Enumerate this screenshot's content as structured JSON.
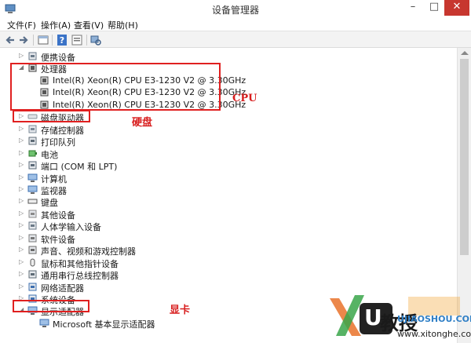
{
  "window": {
    "title": "设备管理器"
  },
  "menu": [
    "文件(F)",
    "操作(A)",
    "查看(V)",
    "帮助(H)"
  ],
  "tree": {
    "items": [
      {
        "label": "便携设备",
        "expanded": false,
        "icon": "portable-device-icon"
      },
      {
        "label": "处理器",
        "expanded": true,
        "icon": "processor-icon"
      },
      {
        "label": "Intel(R) Xeon(R) CPU E3-1230 V2 @ 3.30GHz",
        "child": true,
        "icon": "cpu-icon"
      },
      {
        "label": "Intel(R) Xeon(R) CPU E3-1230 V2 @ 3.30GHz",
        "child": true,
        "icon": "cpu-icon"
      },
      {
        "label": "Intel(R) Xeon(R) CPU E3-1230 V2 @ 3.30GHz",
        "child": true,
        "icon": "cpu-icon"
      },
      {
        "label": "磁盘驱动器",
        "expanded": false,
        "icon": "disk-drive-icon"
      },
      {
        "label": "存储控制器",
        "expanded": false,
        "icon": "storage-controller-icon"
      },
      {
        "label": "打印队列",
        "expanded": false,
        "icon": "print-queue-icon"
      },
      {
        "label": "电池",
        "expanded": false,
        "icon": "battery-icon"
      },
      {
        "label": "端口 (COM 和 LPT)",
        "expanded": false,
        "icon": "port-icon"
      },
      {
        "label": "计算机",
        "expanded": false,
        "icon": "computer-icon"
      },
      {
        "label": "监视器",
        "expanded": false,
        "icon": "monitor-icon"
      },
      {
        "label": "键盘",
        "expanded": false,
        "icon": "keyboard-icon"
      },
      {
        "label": "其他设备",
        "expanded": false,
        "icon": "other-device-icon"
      },
      {
        "label": "人体学输入设备",
        "expanded": false,
        "icon": "hid-icon"
      },
      {
        "label": "软件设备",
        "expanded": false,
        "icon": "software-device-icon"
      },
      {
        "label": "声音、视频和游戏控制器",
        "expanded": false,
        "icon": "sound-icon"
      },
      {
        "label": "鼠标和其他指针设备",
        "expanded": false,
        "icon": "mouse-icon"
      },
      {
        "label": "通用串行总线控制器",
        "expanded": false,
        "icon": "usb-icon"
      },
      {
        "label": "网络适配器",
        "expanded": false,
        "icon": "network-adapter-icon"
      },
      {
        "label": "系统设备",
        "expanded": false,
        "icon": "system-device-icon"
      },
      {
        "label": "显示适配器",
        "expanded": true,
        "icon": "display-adapter-icon"
      },
      {
        "label": "Microsoft 基本显示适配器",
        "child": true,
        "icon": "display-device-icon"
      }
    ]
  },
  "annotations": {
    "cpu": "CPU",
    "disk": "硬盘",
    "gpu": "显卡"
  },
  "watermark": {
    "brand_a": "U",
    "brand_b": "教授",
    "sub": "UJIAOSHOU.COM",
    "url": "www.xitonghe.com"
  },
  "colors": {
    "annotation": "#d81e1e",
    "close_button": "#c7372f"
  }
}
